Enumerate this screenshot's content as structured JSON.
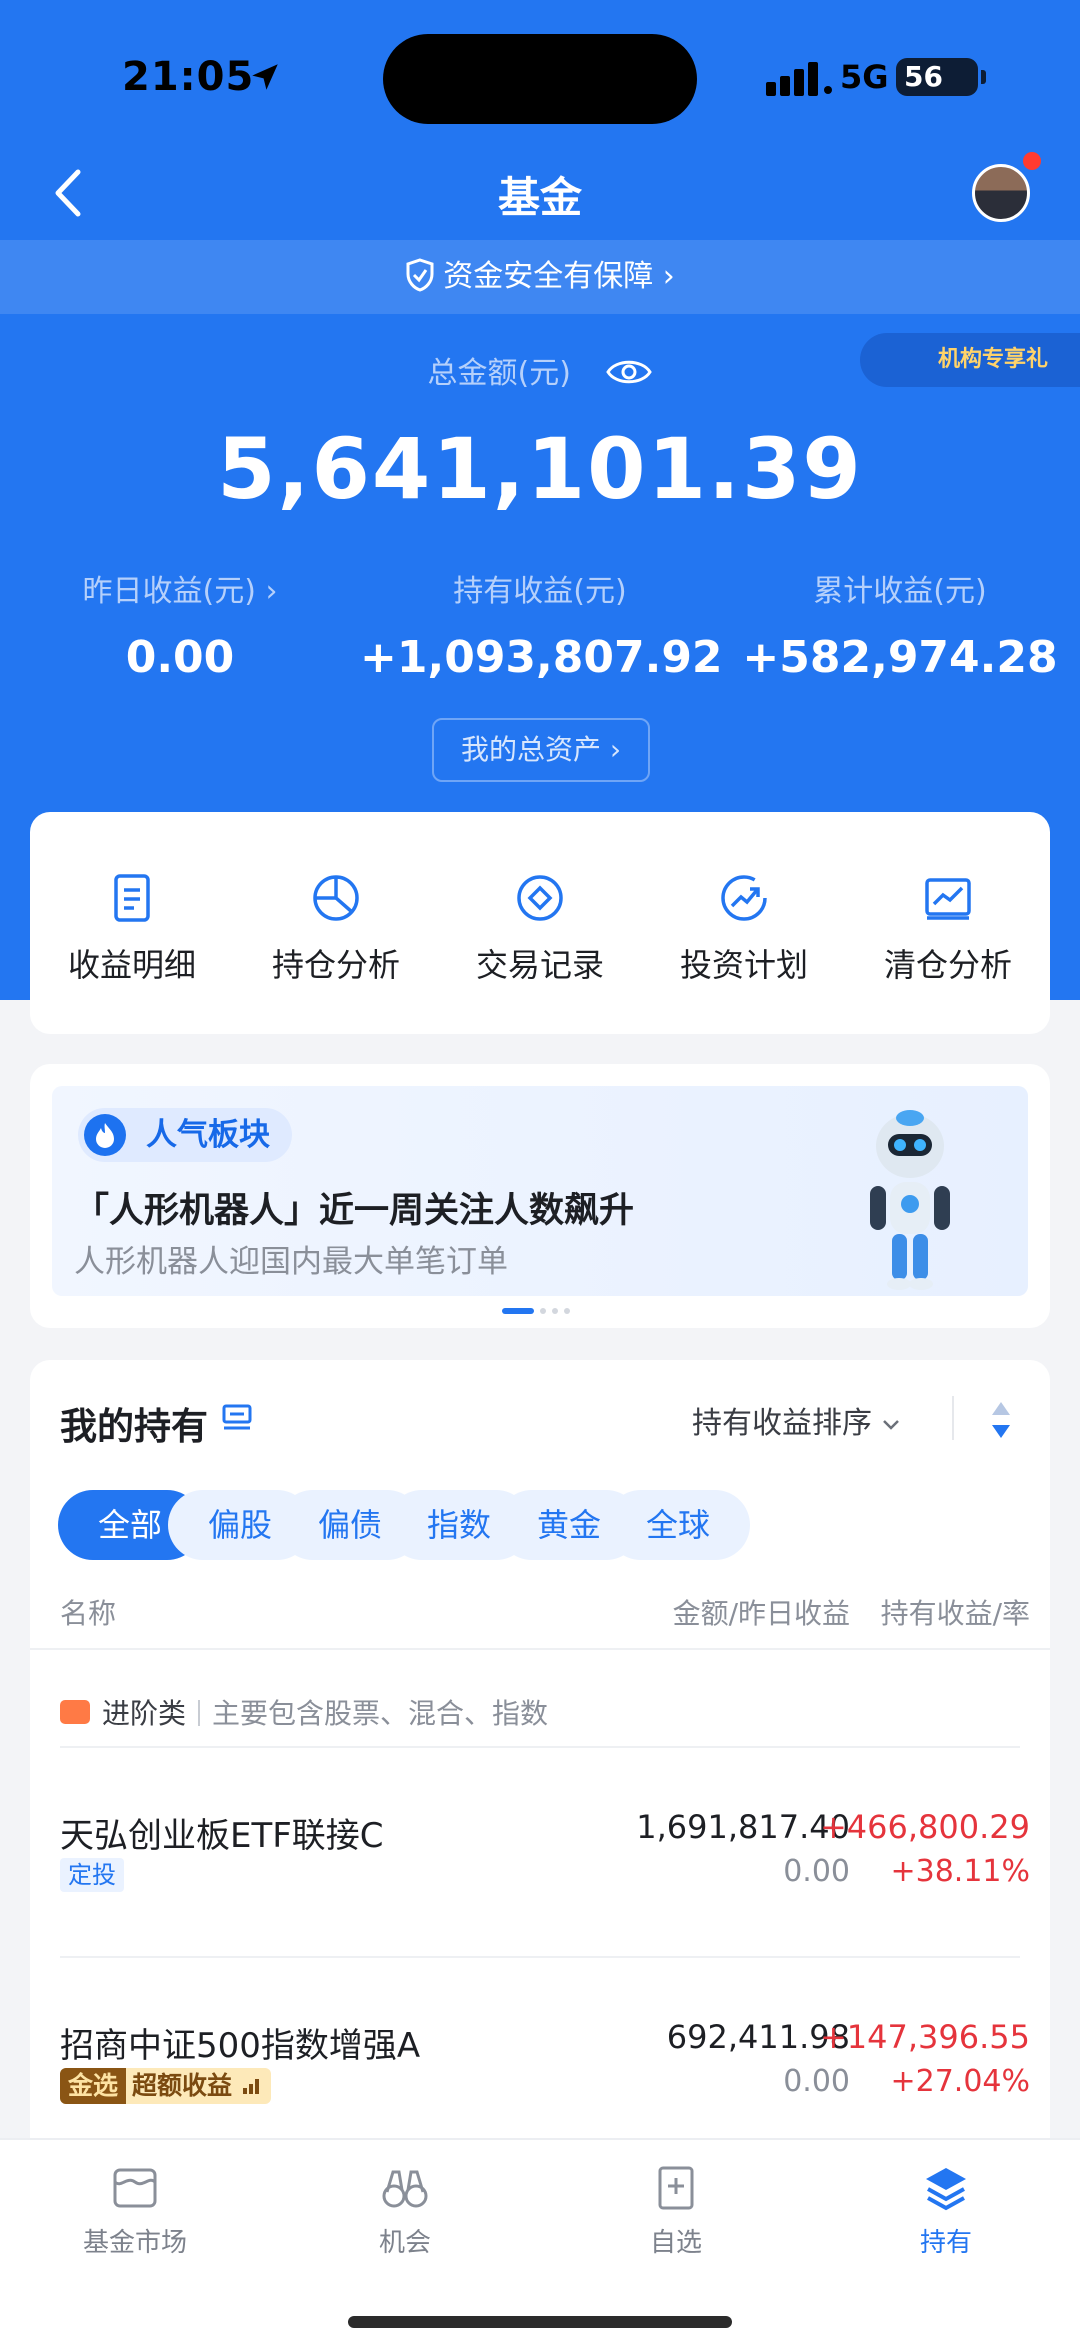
{
  "status": {
    "time": "21:05",
    "network": "5G",
    "battery": "56"
  },
  "nav": {
    "title": "基金"
  },
  "security": {
    "text": "资金安全有保障"
  },
  "badge": {
    "text": "机构专享礼"
  },
  "summary": {
    "total_label": "总金额(元)",
    "total_amount": "5,641,101.39",
    "stats": [
      {
        "label": "昨日收益(元) ›",
        "value": "0.00"
      },
      {
        "label": "持有收益(元)",
        "value": "+1,093,807.92"
      },
      {
        "label": "累计收益(元)",
        "value": "+582,974.28"
      }
    ],
    "assets_button": "我的总资产 ›"
  },
  "tools": [
    {
      "label": "收益明细",
      "icon": "document-icon"
    },
    {
      "label": "持仓分析",
      "icon": "pie-chart-icon"
    },
    {
      "label": "交易记录",
      "icon": "diamond-circle-icon"
    },
    {
      "label": "投资计划",
      "icon": "trend-up-icon"
    },
    {
      "label": "清仓分析",
      "icon": "line-chart-icon"
    }
  ],
  "banner": {
    "tag": "人气板块",
    "title": "「人形机器人」近一周关注人数飙升",
    "subtitle": "人形机器人迎国内最大单笔订单"
  },
  "holdings": {
    "title": "我的持有",
    "sort_label": "持有收益排序",
    "chips": [
      "全部",
      "偏股",
      "偏债",
      "指数",
      "黄金",
      "全球"
    ],
    "columns": {
      "name": "名称",
      "amount": "金额/昨日收益",
      "profit": "持有收益/率"
    },
    "category": {
      "name": "进阶类",
      "desc": "主要包含股票、混合、指数"
    },
    "funds": [
      {
        "name": "天弘创业板ETF联接C",
        "tag": "定投",
        "amount": "1,691,817.40",
        "yesterday": "0.00",
        "profit": "+466,800.29",
        "rate": "+38.11%"
      },
      {
        "name": "招商中证500指数增强A",
        "tag_prefix": "金选",
        "tag": "超额收益",
        "amount": "692,411.98",
        "yesterday": "0.00",
        "profit": "+147,396.55",
        "rate": "+27.04%"
      }
    ]
  },
  "tabbar": [
    {
      "label": "基金市场",
      "active": false
    },
    {
      "label": "机会",
      "active": false
    },
    {
      "label": "自选",
      "active": false
    },
    {
      "label": "持有",
      "active": true
    }
  ],
  "colors": {
    "brand": "#2376f1",
    "profit": "#e5343c",
    "background": "#f3f4f7"
  }
}
